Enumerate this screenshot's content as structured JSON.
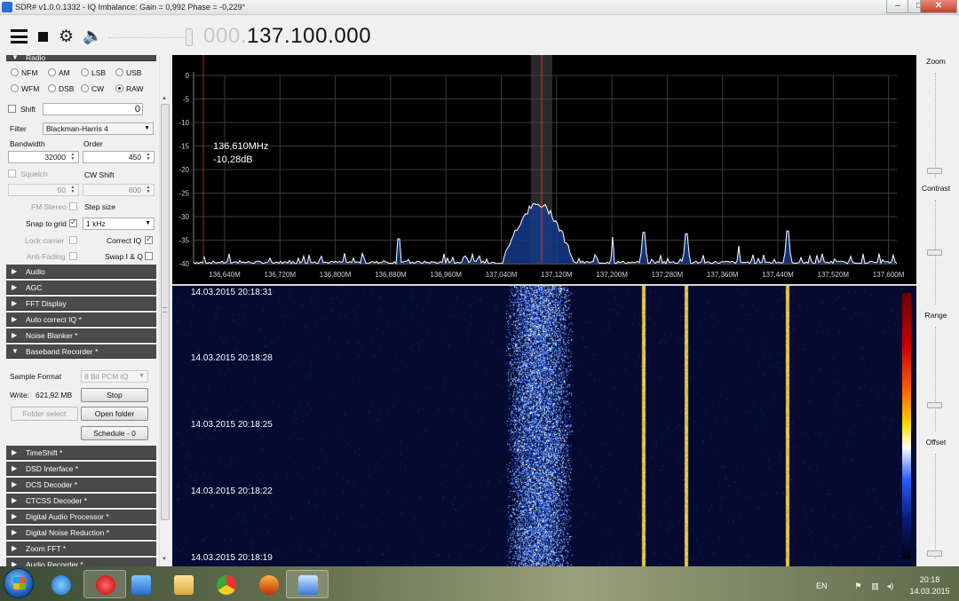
{
  "window": {
    "title": "SDR# v1.0.0.1332 - IQ Imbalance: Gain = 0,992 Phase = -0,229°",
    "minimize": "–",
    "maximize": "□",
    "close": "✕"
  },
  "toolbar": {
    "freq_dim": "000.",
    "freq_main": "137.100.000",
    "icons": [
      "menu-icon",
      "stop-icon",
      "gear-icon",
      "speaker-icon"
    ]
  },
  "radio": {
    "header": "Radio",
    "modes": [
      {
        "label": "NFM",
        "selected": false
      },
      {
        "label": "AM",
        "selected": false
      },
      {
        "label": "LSB",
        "selected": false
      },
      {
        "label": "USB",
        "selected": false
      },
      {
        "label": "WFM",
        "selected": false
      },
      {
        "label": "DSB",
        "selected": false
      },
      {
        "label": "CW",
        "selected": false
      },
      {
        "label": "RAW",
        "selected": true
      }
    ],
    "shift_label": "Shift",
    "shift_value": "0",
    "filter_label": "Filter",
    "filter_value": "Blackman-Harris 4",
    "bandwidth_label": "Bandwidth",
    "bandwidth_value": "32000",
    "order_label": "Order",
    "order_value": "450",
    "squelch_label": "Squelch",
    "squelch_value": "50",
    "cwshift_label": "CW Shift",
    "cwshift_value": "600",
    "fmstereo_label": "FM Stereo",
    "stepsize_label": "Step size",
    "snap_label": "Snap to grid",
    "snap_value": "1 kHz",
    "lockcarrier_label": "Lock carrier",
    "correctiq_label": "Correct IQ",
    "antifading_label": "Anti-Fading",
    "swapiq_label": "Swap I & Q"
  },
  "sections_top": [
    "Audio",
    "AGC",
    "FFT Display",
    "Auto correct IQ *",
    "Noise Blanker *"
  ],
  "baseband": {
    "header": "Baseband Recorder *",
    "sample_format_label": "Sample Format",
    "sample_format_value": "8 Bit PCM IQ",
    "write_label": "Write:",
    "write_value": "621,92 MB",
    "stop_label": "Stop",
    "folder_select_label": "Folder select",
    "open_folder_label": "Open folder",
    "schedule_label": "Schedule - 0"
  },
  "sections_bottom": [
    "TimeShift *",
    "DSD Interface *",
    "DCS Decoder *",
    "CTCSS Decoder *",
    "Digital Audio Processor *",
    "Digital Noise Reduction *",
    "Zoom FFT *",
    "Audio Recorder *"
  ],
  "spectrum": {
    "cursor_freq": "136,610MHz",
    "cursor_db": "-10,28dB",
    "y_ticks": [
      "0",
      "-5",
      "-10",
      "-15",
      "-20",
      "-25",
      "-30",
      "-35",
      "-40"
    ],
    "x_ticks": [
      "136,640M",
      "136,720M",
      "136,800M",
      "136,880M",
      "136,960M",
      "137,040M",
      "137,120M",
      "137,200M",
      "137,280M",
      "137,360M",
      "137,440M",
      "137,520M",
      "137,600M"
    ],
    "colors": {
      "trace": "#ffffff",
      "fill": "#163a8a",
      "cursor": "#d01818",
      "grid": "#3a3a3a",
      "filter": "#555555"
    }
  },
  "waterfall": {
    "timestamps": [
      "14.03.2015 20:18:31",
      "14.03.2015 20:18:28",
      "14.03.2015 20:18:25",
      "14.03.2015 20:18:22",
      "14.03.2015 20:18:19"
    ],
    "colors": {
      "background": "#060a2e",
      "signal": "#4a8cff",
      "carrier": "#f0d24a"
    }
  },
  "controls_right": [
    "Zoom",
    "Contrast",
    "Range",
    "Offset"
  ],
  "taskbar": {
    "apps": [
      "ie-icon",
      "opera-icon",
      "media-icon",
      "folder-icon",
      "chrome-icon",
      "app-icon",
      "sdr-icon"
    ],
    "lang": "EN",
    "time": "20:18",
    "date": "14.03.2015"
  }
}
